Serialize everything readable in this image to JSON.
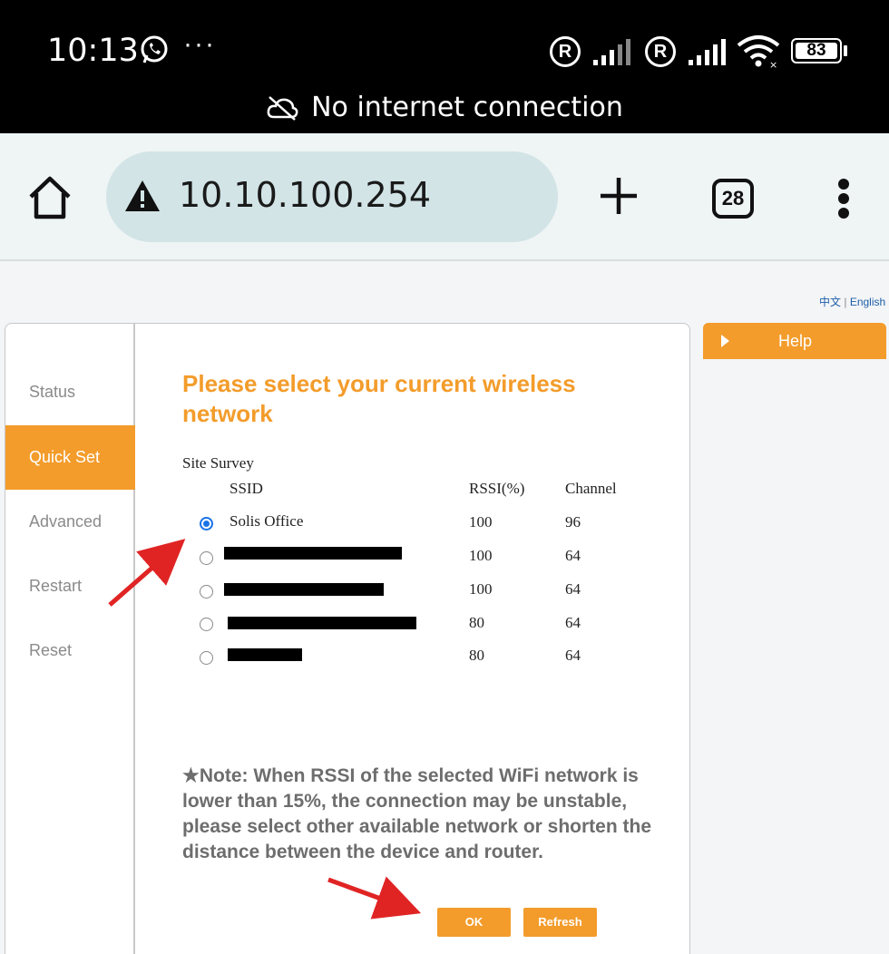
{
  "status_bar": {
    "time": "10:13",
    "ellipsis": "···",
    "sim1_badge": "R",
    "sim2_badge": "R",
    "battery": "83",
    "connection_text": "No internet connection"
  },
  "browser": {
    "url": "10.10.100.254",
    "tab_count": "28"
  },
  "page": {
    "lang_cn": "中文",
    "lang_sep": "|",
    "lang_en": "English",
    "nav": [
      {
        "label": "Status",
        "active": false
      },
      {
        "label": "Quick Set",
        "active": true
      },
      {
        "label": "Advanced",
        "active": false
      },
      {
        "label": "Restart",
        "active": false
      },
      {
        "label": "Reset",
        "active": false
      }
    ],
    "heading": "Please select your current wireless network",
    "site_survey_label": "Site Survey",
    "columns": {
      "ssid": "SSID",
      "rssi": "RSSI(%)",
      "channel": "Channel"
    },
    "networks": [
      {
        "ssid": "Solis Office",
        "rssi": "100",
        "channel": "96",
        "selected": true,
        "redacted": false
      },
      {
        "ssid": "",
        "rssi": "100",
        "channel": "64",
        "selected": false,
        "redacted": true
      },
      {
        "ssid": "",
        "rssi": "100",
        "channel": "64",
        "selected": false,
        "redacted": true
      },
      {
        "ssid": "",
        "rssi": "80",
        "channel": "64",
        "selected": false,
        "redacted": true
      },
      {
        "ssid": "",
        "rssi": "80",
        "channel": "64",
        "selected": false,
        "redacted": true
      }
    ],
    "note": "★Note: When RSSI of the selected WiFi network is lower than 15%, the connection may be unstable, please select other available network or shorten the distance between the device and router.",
    "ok_label": "OK",
    "refresh_label": "Refresh",
    "help_label": "Help"
  },
  "colors": {
    "accent": "#f39c2b",
    "radio_selected": "#1a73e8",
    "annotation_arrow": "#e02424"
  }
}
